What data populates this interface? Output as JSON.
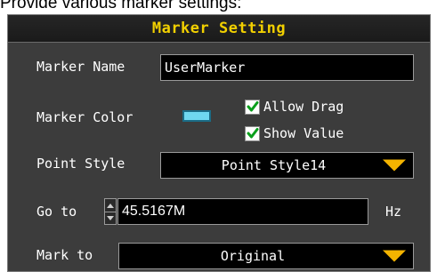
{
  "caption": "Provide various marker settings:",
  "dialog": {
    "title": "Marker Setting",
    "marker_name": {
      "label": "Marker Name",
      "value": "UserMarker"
    },
    "marker_color": {
      "label": "Marker Color",
      "color": "#6fd8f0"
    },
    "allow_drag": {
      "label": "Allow Drag",
      "checked": true
    },
    "show_value": {
      "label": "Show Value",
      "checked": true
    },
    "point_style": {
      "label": "Point Style",
      "value": "Point Style14"
    },
    "go_to": {
      "label": "Go to",
      "value": "45.5167M",
      "unit": "Hz"
    },
    "mark_to": {
      "label": "Mark to",
      "value": "Original"
    }
  },
  "colors": {
    "title": "#f2d000",
    "panel_bg": "#3c3c3c",
    "dropdown_arrow": "#f4b400",
    "check": "#0a9f1c"
  },
  "icons": [
    "checkmark-icon",
    "dropdown-arrow-icon",
    "spin-up-icon",
    "spin-down-icon"
  ]
}
